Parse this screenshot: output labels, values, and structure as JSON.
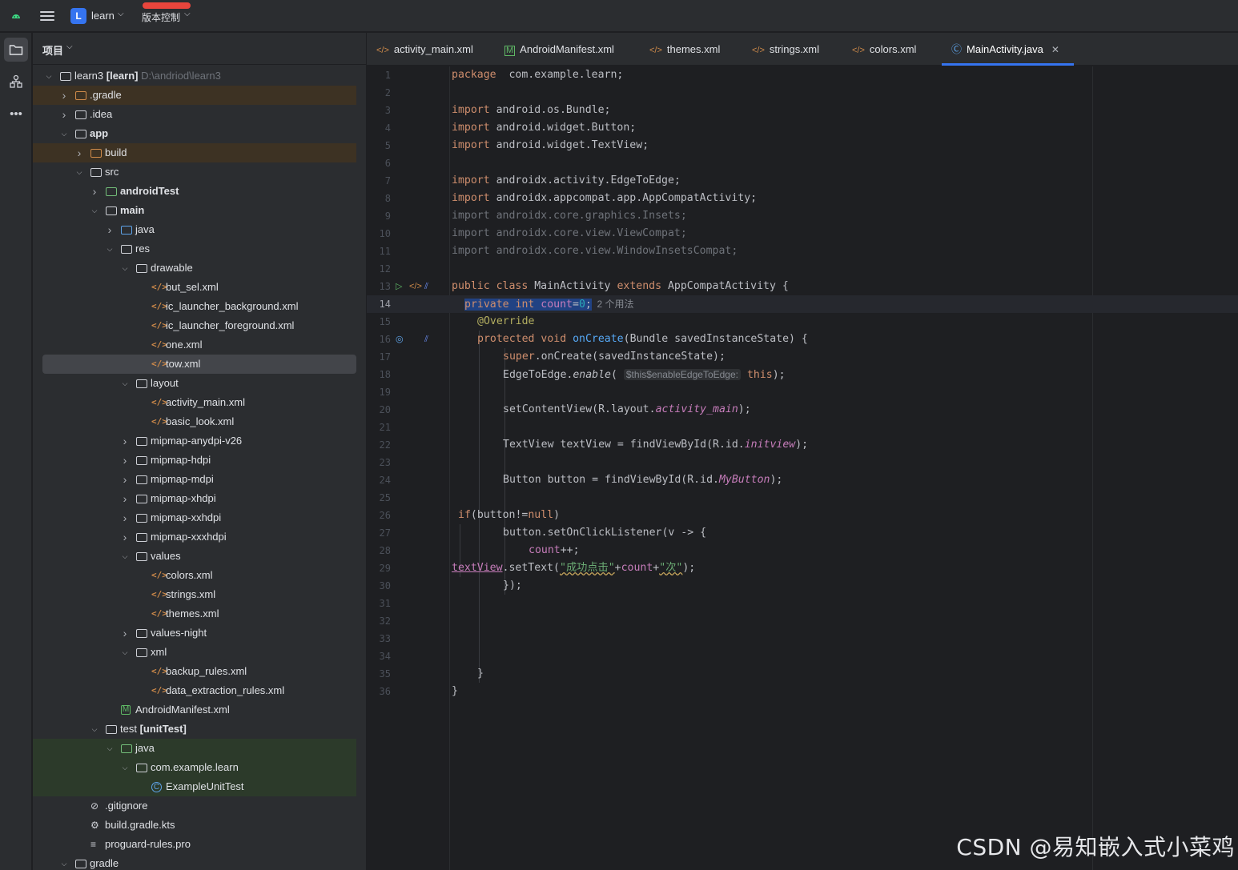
{
  "topbar": {
    "project_badge": "L",
    "project_name": "learn",
    "vcs_label": "版本控制"
  },
  "project_panel": {
    "title": "项目"
  },
  "tree": [
    {
      "depth": 0,
      "expanded": true,
      "icon": "module-folder",
      "label": "learn3 [learn]",
      "extra": "D:\\andriod\\learn3",
      "bold_part": "[learn]"
    },
    {
      "depth": 1,
      "expanded": false,
      "icon": "folder-orange",
      "label": ".gradle",
      "highlight": "orange"
    },
    {
      "depth": 1,
      "expanded": false,
      "icon": "folder",
      "label": ".idea"
    },
    {
      "depth": 1,
      "expanded": true,
      "icon": "module-folder",
      "label": "app",
      "bold": true
    },
    {
      "depth": 2,
      "expanded": false,
      "icon": "folder-orange",
      "label": "build",
      "highlight": "orange"
    },
    {
      "depth": 2,
      "expanded": true,
      "icon": "folder",
      "label": "src"
    },
    {
      "depth": 3,
      "expanded": false,
      "icon": "folder-green",
      "label": "androidTest",
      "bold": true
    },
    {
      "depth": 3,
      "expanded": true,
      "icon": "folder",
      "label": "main",
      "bold": true
    },
    {
      "depth": 4,
      "expanded": false,
      "icon": "folder-blue",
      "label": "java"
    },
    {
      "depth": 4,
      "expanded": true,
      "icon": "folder",
      "label": "res"
    },
    {
      "depth": 5,
      "expanded": true,
      "icon": "folder",
      "label": "drawable"
    },
    {
      "depth": 6,
      "icon": "xml",
      "label": "but_sel.xml"
    },
    {
      "depth": 6,
      "icon": "xml",
      "label": "ic_launcher_background.xml"
    },
    {
      "depth": 6,
      "icon": "xml",
      "label": "ic_launcher_foreground.xml"
    },
    {
      "depth": 6,
      "icon": "xml",
      "label": "one.xml"
    },
    {
      "depth": 6,
      "icon": "xml",
      "label": "tow.xml",
      "selected": true
    },
    {
      "depth": 5,
      "expanded": true,
      "icon": "folder",
      "label": "layout"
    },
    {
      "depth": 6,
      "icon": "xml",
      "label": "activity_main.xml"
    },
    {
      "depth": 6,
      "icon": "xml",
      "label": "basic_look.xml"
    },
    {
      "depth": 5,
      "expanded": false,
      "icon": "folder",
      "label": "mipmap-anydpi-v26"
    },
    {
      "depth": 5,
      "expanded": false,
      "icon": "folder",
      "label": "mipmap-hdpi"
    },
    {
      "depth": 5,
      "expanded": false,
      "icon": "folder",
      "label": "mipmap-mdpi"
    },
    {
      "depth": 5,
      "expanded": false,
      "icon": "folder",
      "label": "mipmap-xhdpi"
    },
    {
      "depth": 5,
      "expanded": false,
      "icon": "folder",
      "label": "mipmap-xxhdpi"
    },
    {
      "depth": 5,
      "expanded": false,
      "icon": "folder",
      "label": "mipmap-xxxhdpi"
    },
    {
      "depth": 5,
      "expanded": true,
      "icon": "folder",
      "label": "values"
    },
    {
      "depth": 6,
      "icon": "xml",
      "label": "colors.xml"
    },
    {
      "depth": 6,
      "icon": "xml",
      "label": "strings.xml"
    },
    {
      "depth": 6,
      "icon": "xml",
      "label": "themes.xml"
    },
    {
      "depth": 5,
      "expanded": false,
      "icon": "folder",
      "label": "values-night"
    },
    {
      "depth": 5,
      "expanded": true,
      "icon": "folder",
      "label": "xml"
    },
    {
      "depth": 6,
      "icon": "xml",
      "label": "backup_rules.xml"
    },
    {
      "depth": 6,
      "icon": "xml",
      "label": "data_extraction_rules.xml"
    },
    {
      "depth": 4,
      "icon": "manifest",
      "label": "AndroidManifest.xml"
    },
    {
      "depth": 3,
      "expanded": true,
      "icon": "folder",
      "label": "test [unitTest]",
      "bold_part": "[unitTest]"
    },
    {
      "depth": 4,
      "expanded": true,
      "icon": "folder-green",
      "label": "java",
      "highlight": "green"
    },
    {
      "depth": 5,
      "expanded": true,
      "icon": "package",
      "label": "com.example.learn",
      "highlight": "green"
    },
    {
      "depth": 6,
      "icon": "class",
      "label": "ExampleUnitTest",
      "highlight": "green"
    },
    {
      "depth": 2,
      "icon": "ignore",
      "label": ".gitignore"
    },
    {
      "depth": 2,
      "icon": "gradle",
      "label": "build.gradle.kts"
    },
    {
      "depth": 2,
      "icon": "text",
      "label": "proguard-rules.pro"
    },
    {
      "depth": 1,
      "expanded": true,
      "icon": "folder",
      "label": "gradle"
    }
  ],
  "tabs": [
    {
      "icon": "xml",
      "label": "activity_main.xml"
    },
    {
      "icon": "manifest",
      "label": "AndroidManifest.xml"
    },
    {
      "icon": "xml",
      "label": "themes.xml"
    },
    {
      "icon": "xml",
      "label": "strings.xml"
    },
    {
      "icon": "xml",
      "label": "colors.xml"
    },
    {
      "icon": "class",
      "label": "MainActivity.java",
      "active": true
    }
  ],
  "editor": {
    "current_line": 14,
    "line_count": 36,
    "lines": [
      [
        [
          "kw",
          "package"
        ],
        [
          "",
          "  com.example.learn;"
        ]
      ],
      [],
      [
        [
          "kw",
          "import"
        ],
        [
          "",
          " android.os.Bundle;"
        ]
      ],
      [
        [
          "kw",
          "import"
        ],
        [
          "",
          " android.widget.Button;"
        ]
      ],
      [
        [
          "kw",
          "import"
        ],
        [
          "",
          " android.widget.TextView;"
        ]
      ],
      [],
      [
        [
          "kw",
          "import"
        ],
        [
          "",
          " androidx.activity.EdgeToEdge;"
        ]
      ],
      [
        [
          "kw",
          "import"
        ],
        [
          "",
          " androidx.appcompat.app.AppCompatActivity;"
        ]
      ],
      [
        [
          "grey",
          "import androidx.core.graphics.Insets;"
        ]
      ],
      [
        [
          "grey",
          "import androidx.core.view.ViewCompat;"
        ]
      ],
      [
        [
          "grey",
          "import androidx.core.view.WindowInsetsCompat;"
        ]
      ],
      [],
      [
        [
          "kw",
          "public class"
        ],
        [
          "",
          " MainActivity "
        ],
        [
          "kw",
          "extends"
        ],
        [
          "",
          " AppCompatActivity {"
        ]
      ],
      [
        [
          "",
          ""
        ],
        [
          "sel kw",
          "private int"
        ],
        [
          "sel fld",
          " count"
        ],
        [
          "sel",
          "="
        ],
        [
          "sel num",
          "0"
        ],
        [
          "sel",
          ";"
        ],
        [
          "hint",
          "  2 个用法"
        ]
      ],
      [
        [
          "",
          ""
        ],
        [
          "ann",
          "@Override"
        ]
      ],
      [
        [
          "",
          ""
        ],
        [
          "kw",
          "protected void"
        ],
        [
          "fn",
          " onCreate"
        ],
        [
          "",
          "(Bundle savedInstanceState) {"
        ]
      ],
      [
        [
          "",
          ""
        ],
        [
          "kw",
          "super"
        ],
        [
          "",
          ".onCreate(savedInstanceState);"
        ]
      ],
      [
        [
          "",
          ""
        ],
        [
          "",
          "EdgeToEdge."
        ],
        [
          "it",
          "enable"
        ],
        [
          "",
          "( "
        ],
        [
          "inlay",
          "$this$enableEdgeToEdge:"
        ],
        [
          "kw",
          " this"
        ],
        [
          "",
          ");"
        ]
      ],
      [],
      [
        [
          "",
          ""
        ],
        [
          "",
          "setContentView(R.layout."
        ],
        [
          "fld it",
          "activity_main"
        ],
        [
          "",
          ");"
        ]
      ],
      [],
      [
        [
          "",
          ""
        ],
        [
          "",
          "TextView textView = findViewById(R.id."
        ],
        [
          "fld it",
          "initview"
        ],
        [
          "",
          ");"
        ]
      ],
      [],
      [
        [
          "",
          ""
        ],
        [
          "",
          "Button button = findViewById(R.id."
        ],
        [
          "fld it",
          "MyButton"
        ],
        [
          "",
          ");"
        ]
      ],
      [],
      [
        [
          "",
          ""
        ],
        [
          "kw",
          "if"
        ],
        [
          "",
          "(button!="
        ],
        [
          "kw",
          "null"
        ],
        [
          "",
          ")"
        ]
      ],
      [
        [
          "",
          ""
        ],
        [
          "",
          "button.setOnClickListener(v -> {"
        ]
      ],
      [
        [
          "",
          ""
        ],
        [
          "fld",
          "count"
        ],
        [
          "",
          "++;"
        ]
      ],
      [
        [
          "fld uline",
          "textView"
        ],
        [
          "",
          ".setText("
        ],
        [
          "str wavy",
          "\"成功点击\""
        ],
        [
          "",
          "+"
        ],
        [
          "fld",
          "count"
        ],
        [
          "",
          "+"
        ],
        [
          "str wavy",
          "\"次\""
        ],
        [
          "",
          ");"
        ]
      ],
      [
        [
          "",
          ""
        ],
        [
          "",
          "});"
        ]
      ],
      [],
      [],
      [],
      [],
      [
        [
          "",
          ""
        ],
        [
          "",
          "}"
        ]
      ],
      [
        [
          "",
          "}"
        ]
      ]
    ]
  },
  "watermark": "CSDN @易知嵌入式小菜鸡"
}
